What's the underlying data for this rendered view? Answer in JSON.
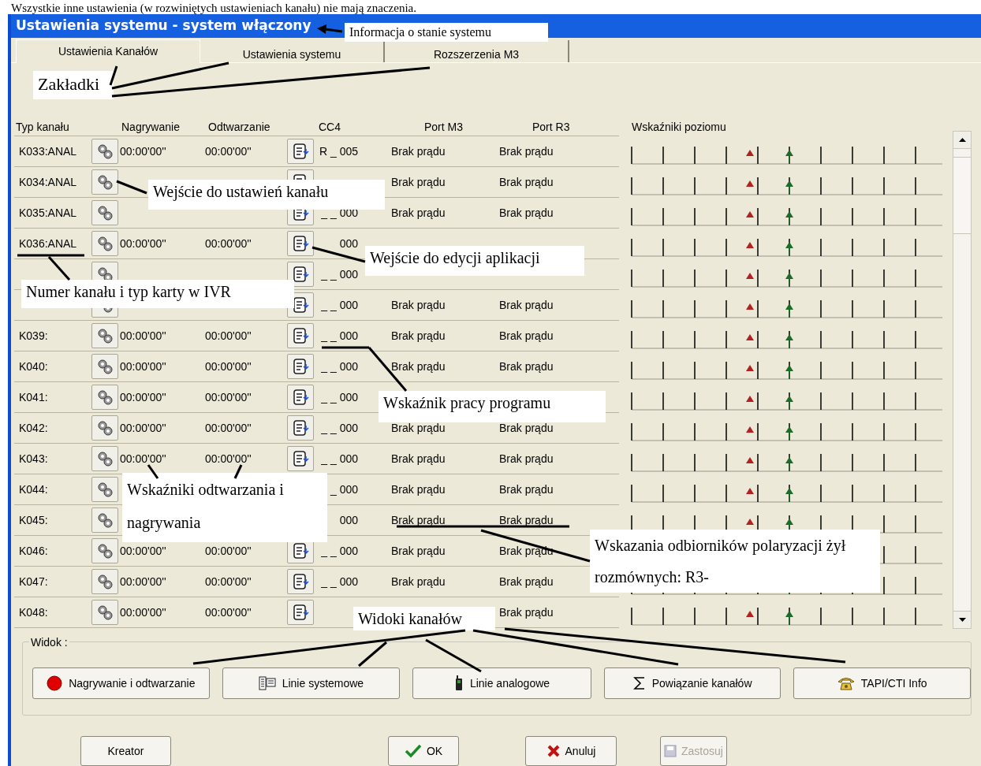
{
  "document_text": "Wszystkie inne ustawienia (w rozwiniętych ustawieniach kanału) nie mają znaczenia.",
  "window": {
    "title": "Ustawienia systemu - system włączony"
  },
  "tabs": [
    {
      "label": "Ustawienia Kanałów",
      "selected": true
    },
    {
      "label": "Ustawienia systemu",
      "selected": false
    },
    {
      "label": "Rozszerzenia M3",
      "selected": false
    }
  ],
  "table": {
    "columns": [
      "Typ kanału",
      "Nagrywanie",
      "Odtwarzanie",
      "CC4",
      "Port M3",
      "Port R3"
    ],
    "meter_heading": "Wskaźniki poziomu",
    "rows": [
      {
        "channel": "K033:ANAL",
        "recording": "00:00'00''",
        "playback": "00:00'00''",
        "edit_button": true,
        "cc4": "R _ 005",
        "port_m3": "Brak prądu",
        "port_r3": "Brak prądu"
      },
      {
        "channel": "K034:ANAL",
        "edit_button": true,
        "port_m3": "Brak prądu",
        "port_r3": "Brak prądu"
      },
      {
        "channel": "K035:ANAL",
        "edit_button": true,
        "cc4": "_ _ 000",
        "port_m3": "Brak prądu",
        "port_r3": "Brak prądu"
      },
      {
        "channel": "K036:ANAL",
        "recording": "00:00'00''",
        "playback": "00:00'00''",
        "edit_button": true,
        "cc4": "000"
      },
      {
        "edit_button": true,
        "cc4": "_ _ 000"
      },
      {
        "edit_button": true,
        "cc4": "_ _ 000",
        "port_m3": "Brak prądu",
        "port_r3": "Brak prądu"
      },
      {
        "channel": "K039:",
        "recording": "00:00'00''",
        "playback": "00:00'00''",
        "edit_button": true,
        "cc4": "_ _ 000",
        "port_m3": "Brak prądu",
        "port_r3": "Brak prądu"
      },
      {
        "channel": "K040:",
        "recording": "00:00'00''",
        "playback": "00:00'00''",
        "edit_button": true,
        "cc4": "_ _ 000",
        "port_m3": "Brak prądu",
        "port_r3": "Brak prądu"
      },
      {
        "channel": "K041:",
        "recording": "00:00'00''",
        "playback": "00:00'00''",
        "edit_button": true,
        "cc4": "_ _ 000"
      },
      {
        "channel": "K042:",
        "recording": "00:00'00''",
        "playback": "00:00'00''",
        "edit_button": true,
        "cc4": "_ _ 000",
        "port_m3": "Brak prądu",
        "port_r3": "Brak prądu"
      },
      {
        "channel": "K043:",
        "recording": "00:00'00''",
        "playback": "00:00'00''",
        "edit_button": true,
        "cc4": "_ _ 000",
        "port_m3": "Brak prądu",
        "port_r3": "Brak prądu"
      },
      {
        "channel": "K044:",
        "edit_button": false,
        "cc4": "_ 000",
        "port_m3": "Brak prądu",
        "port_r3": "Brak prądu"
      },
      {
        "channel": "K045:",
        "edit_button": false,
        "cc4": "000",
        "port_m3": "Brak prądu",
        "port_r3": "Brak prądu"
      },
      {
        "channel": "K046:",
        "recording": "00:00'00''",
        "playback": "00:00'00''",
        "edit_button": true,
        "cc4": "_ _ 000",
        "port_m3": "Brak prądu",
        "port_r3": "Brak prądu"
      },
      {
        "channel": "K047:",
        "recording": "00:00'00''",
        "playback": "00:00'00''",
        "edit_button": true,
        "cc4": "_ _ 000",
        "port_m3": "Brak prądu",
        "port_r3": "Brak prądu"
      },
      {
        "channel": "K048:",
        "recording": "00:00'00''",
        "playback": "00:00'00''",
        "edit_button": true,
        "port_r3": "Brak prądu"
      }
    ]
  },
  "view_group": {
    "label": "Widok :",
    "buttons": [
      {
        "label": "Nagrywanie i odtwarzanie"
      },
      {
        "label": "Linie systemowe"
      },
      {
        "label": "Linie analogowe"
      },
      {
        "label": "Powiązanie kanałów"
      },
      {
        "label": "TAPI/CTI Info"
      }
    ]
  },
  "buttons": [
    {
      "label": "Kreator",
      "disabled": false
    },
    {
      "label": "OK",
      "disabled": false
    },
    {
      "label": "Anuluj",
      "disabled": false
    },
    {
      "label": "Zastosuj",
      "disabled": true
    }
  ],
  "annotations": [
    {
      "text": "Informacja o stanie systemu"
    },
    {
      "text": "Zakładki"
    },
    {
      "text": "Wejście do ustawień kanału"
    },
    {
      "text": "Wejście do edycji aplikacji"
    },
    {
      "text": "Numer kanału i typ karty w IVR"
    },
    {
      "text": "Wskaźnik pracy programu"
    },
    {
      "text": "Wskaźniki odtwarzania i nagrywania"
    },
    {
      "text": "Wskazania odbiorników polaryzacji żył rozmównych: R3-"
    },
    {
      "text": "Widoki kanałów"
    }
  ]
}
